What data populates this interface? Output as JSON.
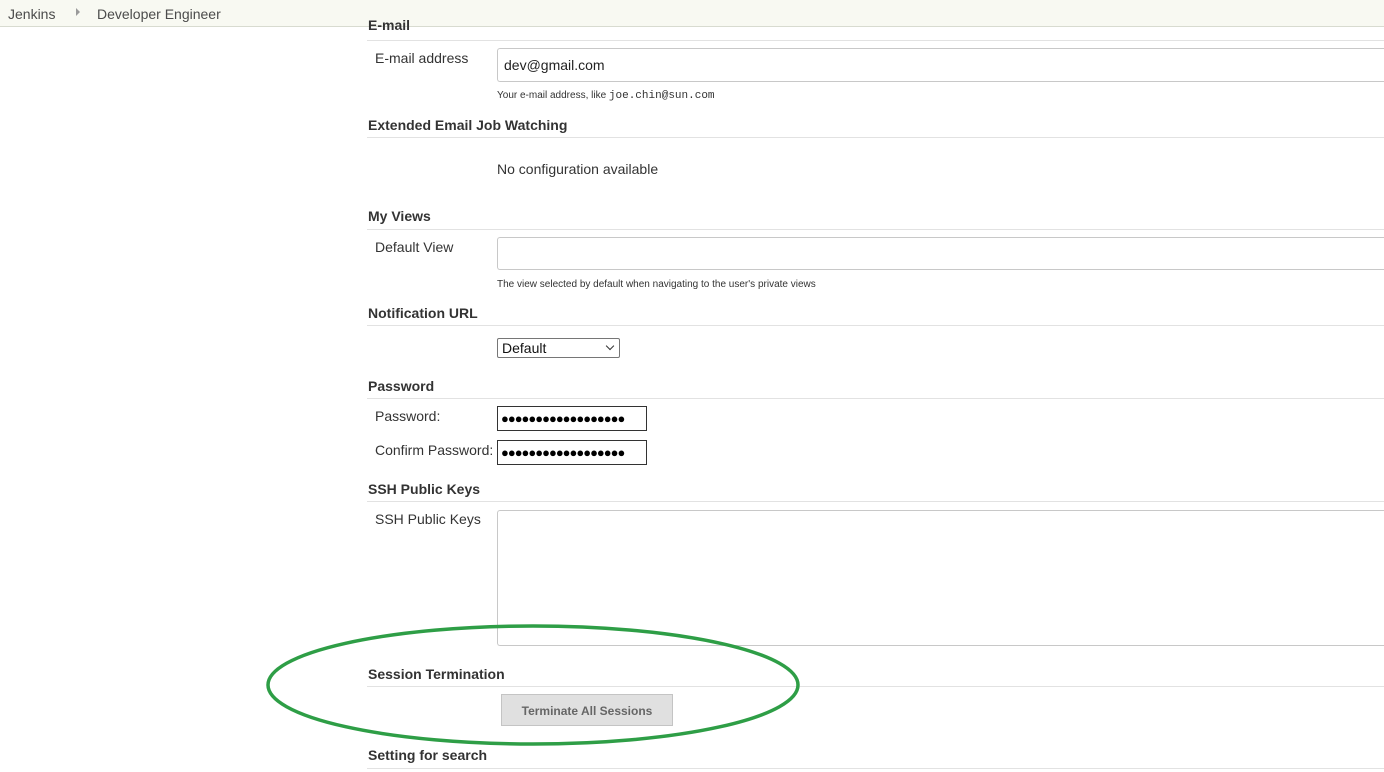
{
  "breadcrumb": {
    "items": [
      "Jenkins",
      "Developer Engineer"
    ]
  },
  "email_section": {
    "heading": "E-mail",
    "field_label": "E-mail address",
    "value": "dev@gmail.com",
    "help_prefix": "Your e-mail address, like ",
    "help_example": "joe.chin@sun.com"
  },
  "ext_email_section": {
    "heading": "Extended Email Job Watching",
    "message": "No configuration available"
  },
  "my_views_section": {
    "heading": "My Views",
    "field_label": "Default View",
    "value": "",
    "help": "The view selected by default when navigating to the user's private views"
  },
  "notification_section": {
    "heading": "Notification URL",
    "selected": "Default"
  },
  "password_section": {
    "heading": "Password",
    "password_label": "Password:",
    "confirm_label": "Confirm Password:",
    "password_mask": "●●●●●●●●●●●●●●●●●●",
    "confirm_mask": "●●●●●●●●●●●●●●●●●●"
  },
  "ssh_section": {
    "heading": "SSH Public Keys",
    "field_label": "SSH Public Keys",
    "value": ""
  },
  "session_section": {
    "heading": "Session Termination",
    "button_label": "Terminate All Sessions"
  },
  "search_section": {
    "heading": "Setting for search"
  },
  "colors": {
    "annotation_ellipse": "#2e9e46",
    "breadcrumb_bg": "#f8f9f2"
  }
}
